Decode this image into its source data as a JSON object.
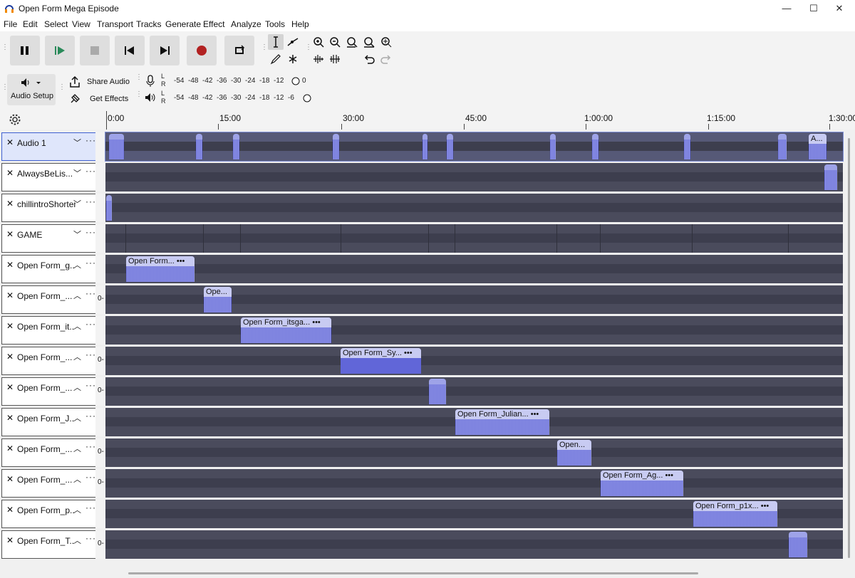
{
  "window": {
    "title": "Open Form Mega Episode",
    "minimize": "—",
    "maximize": "☐",
    "close": "✕"
  },
  "menu": [
    "File",
    "Edit",
    "Select",
    "View",
    "Transport",
    "Tracks",
    "Generate",
    "Effect",
    "Analyze",
    "Tools",
    "Help"
  ],
  "toolbar": {
    "audio_setup_label": "Audio Setup",
    "share_audio_label": "Share Audio",
    "get_effects_label": "Get Effects",
    "rec_meter_ticks": [
      "-54",
      "-48",
      "-42",
      "-36",
      "-30",
      "-24",
      "-18",
      "-12",
      "0"
    ],
    "play_meter_ticks": [
      "-54",
      "-48",
      "-42",
      "-36",
      "-30",
      "-24",
      "-18",
      "-12",
      "-6"
    ],
    "meter_l": "L",
    "meter_r": "R"
  },
  "ruler": {
    "labels": [
      "0:00",
      "15:00",
      "30:00",
      "45:00",
      "1:00:00",
      "1:15:00",
      "1:30:00"
    ]
  },
  "tracks": [
    {
      "name": "Audio 1",
      "chev": "﹀",
      "vlabel": ""
    },
    {
      "name": "AlwaysBeLis...",
      "chev": "﹀",
      "vlabel": ""
    },
    {
      "name": "chillintroShorter",
      "chev": "﹀",
      "vlabel": ""
    },
    {
      "name": "GAME",
      "chev": "﹀",
      "vlabel": ""
    },
    {
      "name": "Open Form_g...",
      "chev": "︿",
      "vlabel": ""
    },
    {
      "name": "Open Form_...",
      "chev": "︿",
      "vlabel": "0-"
    },
    {
      "name": "Open Form_it...",
      "chev": "︿",
      "vlabel": ""
    },
    {
      "name": "Open Form_...",
      "chev": "︿",
      "vlabel": "0-"
    },
    {
      "name": "Open Form_...",
      "chev": "︿",
      "vlabel": "0-"
    },
    {
      "name": "Open Form_J...",
      "chev": "︿",
      "vlabel": ""
    },
    {
      "name": "Open Form_...",
      "chev": "︿",
      "vlabel": "0-"
    },
    {
      "name": "Open Form_...",
      "chev": "︿",
      "vlabel": "0-"
    },
    {
      "name": "Open Form_p...",
      "chev": "︿",
      "vlabel": ""
    },
    {
      "name": "Open Form_T...",
      "chev": "︿",
      "vlabel": "0-"
    }
  ],
  "clips": {
    "audio1_last": "A...",
    "c4": "Open Form...",
    "c5": "Ope...",
    "c6": "Open Form_itsga...",
    "c7": "Open Form_Sy...",
    "c9": "Open Form_Julian...",
    "c10": "Open...",
    "c11": "Open Form_Ag...",
    "c12": "Open Form_p1x..."
  },
  "clip_more": "•••",
  "track_more": "···",
  "track_close": "✕"
}
